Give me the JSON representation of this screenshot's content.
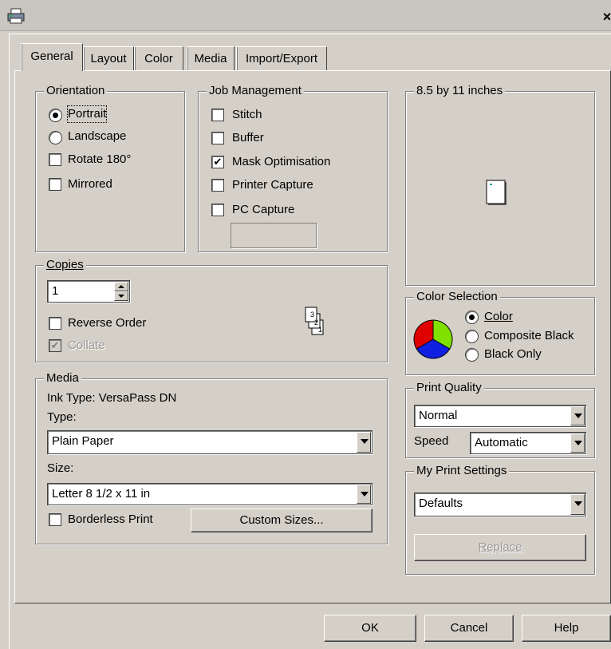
{
  "window": {
    "close_label": "×"
  },
  "tabs": [
    {
      "label": "General",
      "active": true
    },
    {
      "label": "Layout"
    },
    {
      "label": "Color"
    },
    {
      "label": "Media"
    },
    {
      "label": "Import/Export"
    }
  ],
  "orientation": {
    "title": "Orientation",
    "portrait": "Portrait",
    "landscape": "Landscape",
    "rotate": "Rotate 180°",
    "mirrored": "Mirrored",
    "selected": "Portrait"
  },
  "job_management": {
    "title": "Job Management",
    "stitch": "Stitch",
    "buffer": "Buffer",
    "mask": "Mask Optimisation",
    "printer_capture": "Printer Capture",
    "pc_capture": "PC Capture",
    "mask_checked": true,
    "pc_capture_value": ""
  },
  "paper_preview": {
    "title": "8.5 by 11 inches"
  },
  "copies": {
    "title": "Copies",
    "value": "1",
    "reverse_order": "Reverse Order",
    "collate": "Collate",
    "collate_checked": true,
    "stack_pages": [
      "3",
      "2",
      "1"
    ]
  },
  "color_selection": {
    "title": "Color Selection",
    "color": "Color",
    "composite_black": "Composite Black",
    "black_only": "Black Only",
    "selected": "Color",
    "wheel_colors": [
      "#e00000",
      "#80e000",
      "#1020e0"
    ]
  },
  "media": {
    "title": "Media",
    "ink_type": "Ink Type: VersaPass DN",
    "type_label": "Type:",
    "type_value": "Plain Paper",
    "size_label": "Size:",
    "size_value": "Letter 8 1/2 x 11 in",
    "borderless": "Borderless Print",
    "custom_sizes": "Custom Sizes..."
  },
  "print_quality": {
    "title": "Print Quality",
    "quality_value": "Normal",
    "speed_label": "Speed",
    "speed_value": "Automatic"
  },
  "my_print_settings": {
    "title": "My Print Settings",
    "value": "Defaults",
    "replace": "Replace"
  },
  "footer": {
    "ok": "OK",
    "cancel": "Cancel",
    "help": "Help"
  }
}
